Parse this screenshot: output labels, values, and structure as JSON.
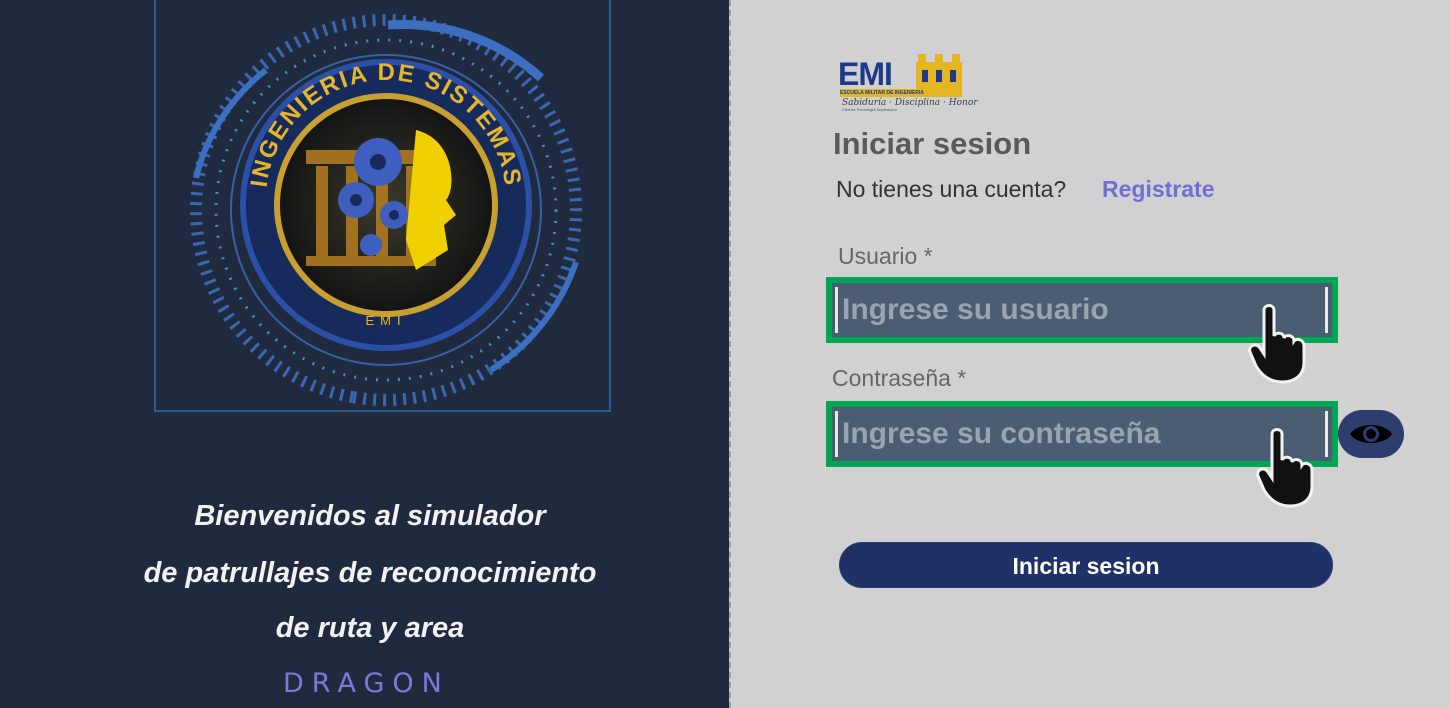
{
  "left_panel": {
    "emblem": {
      "ring_text": "INGENIERIA DE SISTEMAS",
      "bottom_text": "EMI"
    },
    "welcome_lines": [
      "Bienvenidos al simulador",
      "de patrullajes de reconocimiento",
      "de ruta y area"
    ],
    "brand": "DRAGON"
  },
  "logo": {
    "text": "EMI",
    "subtitle": "ESCUELA MILITAR DE INGENIERIA",
    "motto": "Sabiduría · Disciplina · Honor",
    "tagline": "Ciencia Tecnologia Superacion"
  },
  "login": {
    "title": "Iniciar sesion",
    "no_account_text": "No tienes una cuenta?",
    "register_link": "Registrate",
    "username_label": "Usuario *",
    "username_placeholder": "Ingrese su usuario",
    "username_value": "",
    "password_label": "Contraseña *",
    "password_placeholder": "Ingrese su contraseña",
    "password_value": "",
    "submit_label": "Iniciar sesion"
  },
  "colors": {
    "left_bg": "#1f2a3f",
    "right_bg": "#d1d1d1",
    "field_highlight": "#00a651",
    "field_bg": "#4b5d72",
    "button_bg": "#1f3268",
    "link": "#6e6ed4",
    "brand_purple": "#7d79d6"
  },
  "icons": {
    "eye": "eye-icon",
    "pointer": "hand-pointer-icon"
  }
}
